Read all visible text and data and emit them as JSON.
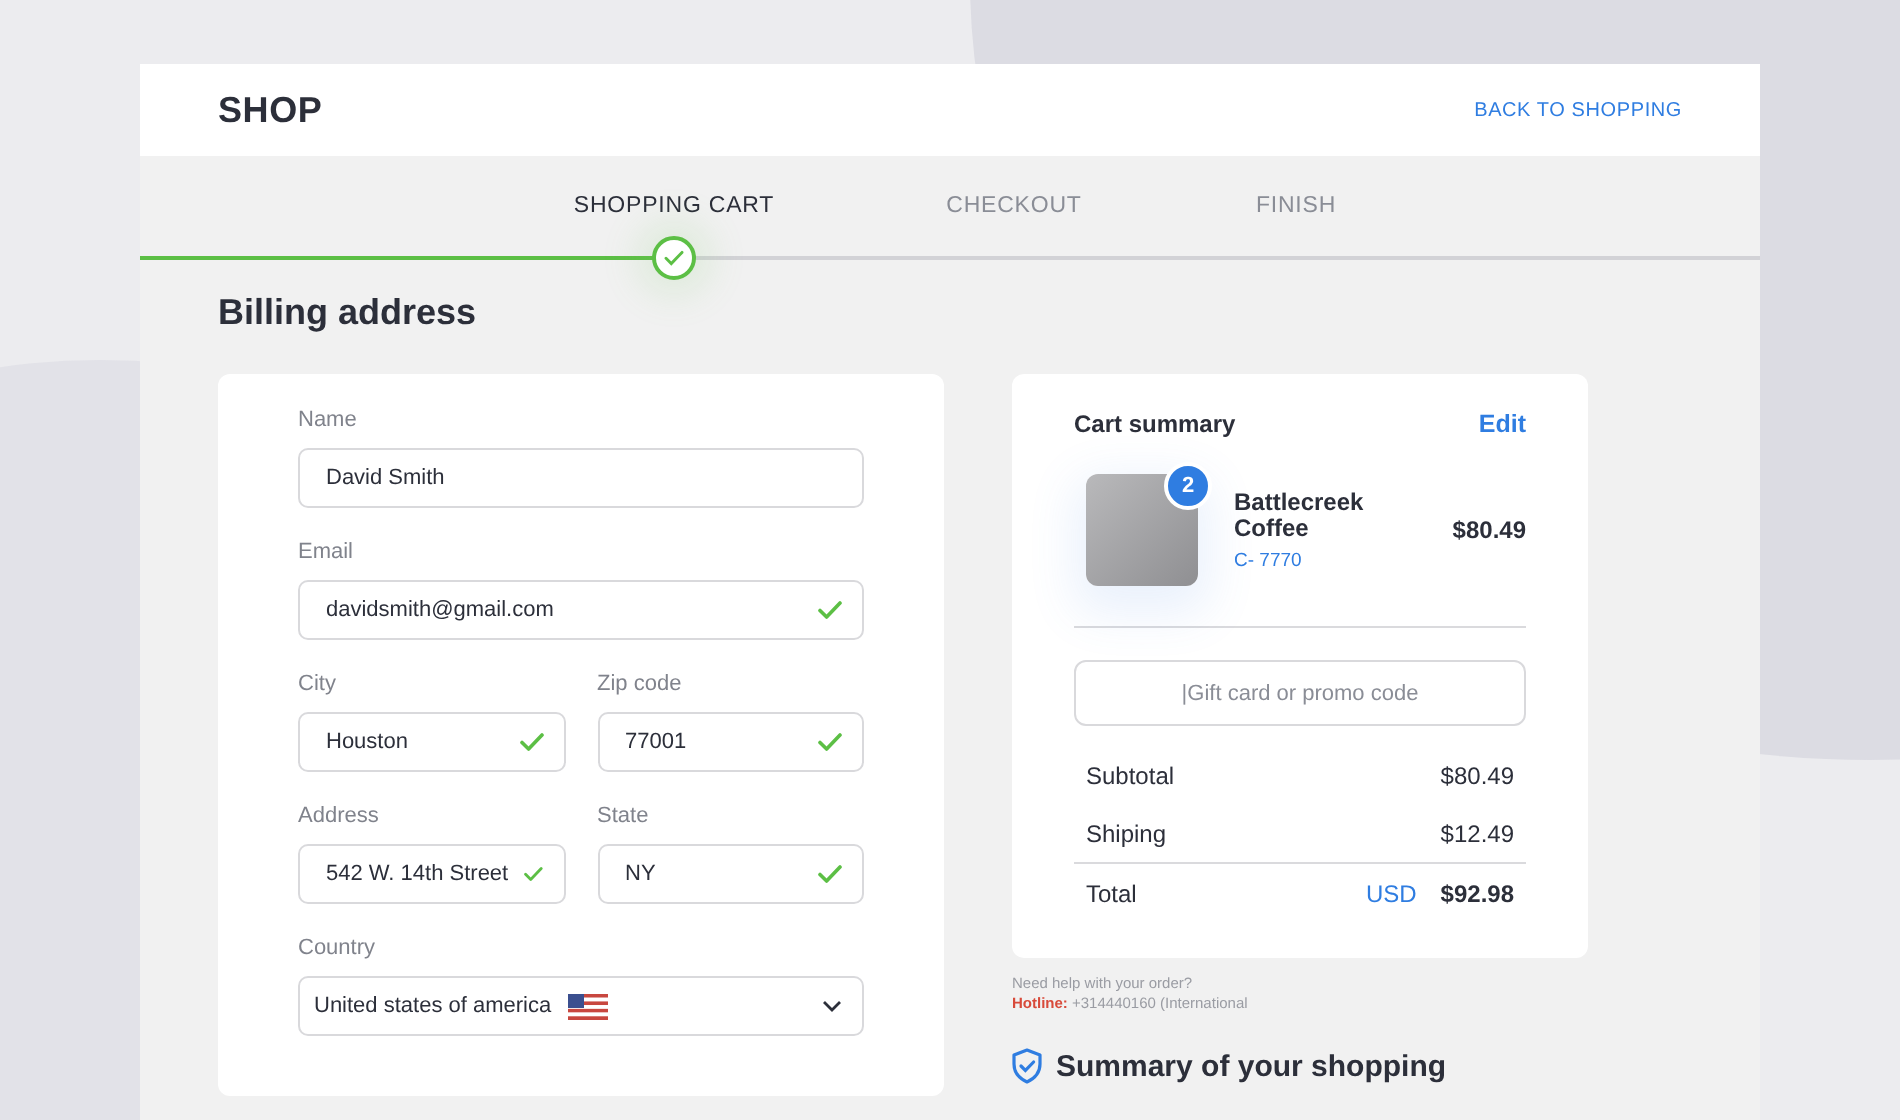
{
  "header": {
    "logo": "SHOP",
    "back_link": "BACK TO SHOPPING"
  },
  "steps": [
    {
      "label": "SHOPPING CART",
      "done": true
    },
    {
      "label": "CHECKOUT",
      "done": false
    },
    {
      "label": "FINISH",
      "done": false
    }
  ],
  "billing": {
    "title": "Billing address",
    "rows": [
      [
        {
          "label": "Name",
          "value": "David Smith",
          "valid": false,
          "kind": "text"
        }
      ],
      [
        {
          "label": "Email",
          "value": "davidsmith@gmail.com",
          "valid": true,
          "kind": "text"
        }
      ],
      [
        {
          "label": "City",
          "value": "Houston",
          "valid": true,
          "kind": "text"
        },
        {
          "label": "Zip code",
          "value": "77001",
          "valid": true,
          "kind": "text"
        }
      ],
      [
        {
          "label": "Address",
          "value": "542 W. 14th Street",
          "valid": true,
          "kind": "text"
        },
        {
          "label": "State",
          "value": "NY",
          "valid": true,
          "kind": "text"
        }
      ],
      [
        {
          "label": "Country",
          "value": "United states of america",
          "kind": "select"
        }
      ]
    ]
  },
  "cart": {
    "title": "Cart summary",
    "edit": "Edit",
    "item": {
      "quantity": "2",
      "name": "Battlecreek Coffee",
      "code": "C- 7770",
      "price": "$80.49"
    },
    "promo": {
      "placeholder": "|Gift card or promo code"
    },
    "lines": [
      {
        "label": "Subtotal",
        "amount": "$80.49",
        "kind": "plain"
      },
      {
        "label": "Shiping",
        "amount": "$12.49",
        "kind": "plain"
      },
      {
        "label": "Total",
        "currency": "USD",
        "amount": "$92.98",
        "kind": "total"
      }
    ]
  },
  "help": {
    "question": "Need help with your order?",
    "hotline": "**Hotline:** +314440160 (International"
  },
  "summary_title": "Summary of your shopping"
}
